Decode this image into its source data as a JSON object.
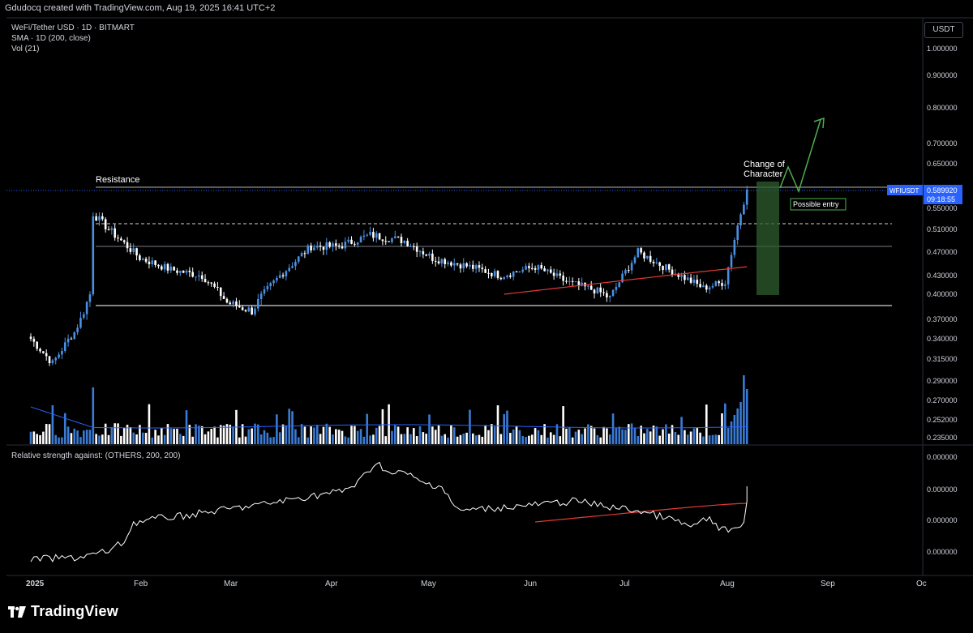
{
  "header": {
    "credit": "Gdudocq created with TradingView.com, Aug 19, 2025 16:41 UTC+2"
  },
  "legend": {
    "symbol_line": "WeFi/Tether USD · 1D · BITMART",
    "sma_line": "SMA · 1D (200, close)",
    "vol_line": "Vol (21)"
  },
  "currency_button": "USDT",
  "price_axis": {
    "ticks": [
      "1.000000",
      "0.900000",
      "0.800000",
      "0.700000",
      "0.650000",
      "0.590000",
      "0.550000",
      "0.510000",
      "0.470000",
      "0.430000",
      "0.400000",
      "0.370000",
      "0.340000",
      "0.315000",
      "0.290000",
      "0.270000",
      "0.252000",
      "0.235000"
    ],
    "current_symbol": "WFIUSDT",
    "current_price": "0.589920",
    "countdown": "09:18:55"
  },
  "lower_pane": {
    "title": "Relative strength against: (OTHERS, 200, 200)",
    "ticks": [
      "0.000000",
      "0.000000",
      "0.000000",
      "0.000000"
    ]
  },
  "time_axis": [
    "2025",
    "Feb",
    "Mar",
    "Apr",
    "May",
    "Jun",
    "Jul",
    "Aug",
    "Sep",
    "Oc"
  ],
  "annotations": {
    "resistance": "Resistance",
    "choch_line1": "Change of",
    "choch_line2": "Character",
    "possible_entry": "Possible entry"
  },
  "brand": {
    "name": "TradingView"
  },
  "colors": {
    "background": "#000000",
    "candle": "#4a90e2",
    "volume": "#3a7bd5",
    "sma": "#e53935",
    "rs_line": "#ffffff",
    "arrow": "#4caf50",
    "highlight": "#2e5e2e",
    "price_label": "#2962ff"
  },
  "chart_data": {
    "type": "candlestick",
    "symbol": "WeFi/Tether USD",
    "timeframe": "1D",
    "exchange": "BITMART",
    "current_price": 0.58992,
    "resistance": 0.59,
    "mid_level": 0.52,
    "range_mid": 0.48,
    "support": 0.385,
    "change_of_character_zone": {
      "from": "2025-08-12",
      "to": "2025-08-19",
      "low": 0.4,
      "high": 0.59
    },
    "projection": [
      [
        "2025-08-19",
        0.59
      ],
      [
        "2025-08-21",
        0.655
      ],
      [
        "2025-08-23",
        0.58
      ],
      [
        "2025-08-29",
        0.78
      ]
    ],
    "approx_close_path": [
      [
        "2025-01-01",
        0.34
      ],
      [
        "2025-01-08",
        0.31
      ],
      [
        "2025-01-15",
        0.35
      ],
      [
        "2025-01-20",
        0.4
      ],
      [
        "2025-01-21",
        0.54
      ],
      [
        "2025-01-26",
        0.51
      ],
      [
        "2025-02-05",
        0.46
      ],
      [
        "2025-02-15",
        0.44
      ],
      [
        "2025-02-25",
        0.43
      ],
      [
        "2025-03-05",
        0.39
      ],
      [
        "2025-03-13",
        0.38
      ],
      [
        "2025-03-22",
        0.43
      ],
      [
        "2025-04-01",
        0.48
      ],
      [
        "2025-04-10",
        0.48
      ],
      [
        "2025-04-20",
        0.5
      ],
      [
        "2025-05-01",
        0.49
      ],
      [
        "2025-05-10",
        0.46
      ],
      [
        "2025-05-22",
        0.445
      ],
      [
        "2025-06-01",
        0.43
      ],
      [
        "2025-06-12",
        0.445
      ],
      [
        "2025-06-22",
        0.42
      ],
      [
        "2025-07-02",
        0.405
      ],
      [
        "2025-07-06",
        0.395
      ],
      [
        "2025-07-15",
        0.47
      ],
      [
        "2025-07-25",
        0.44
      ],
      [
        "2025-08-05",
        0.41
      ],
      [
        "2025-08-12",
        0.42
      ],
      [
        "2025-08-19",
        0.59
      ]
    ]
  }
}
